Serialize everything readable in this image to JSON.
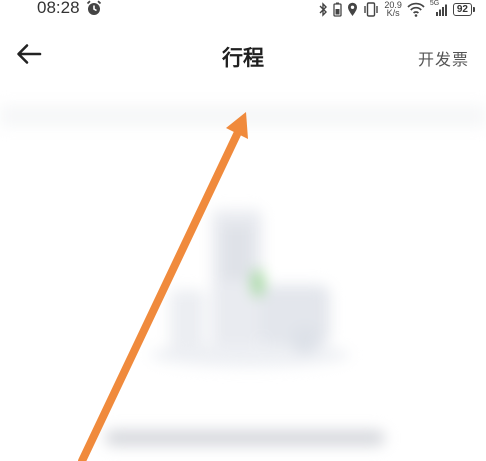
{
  "status_bar": {
    "time": "08:28",
    "net_speed_value": "20.9",
    "net_speed_unit": "K/s",
    "signal_label": "5G",
    "battery": "92",
    "icons": [
      "alarm-icon",
      "bluetooth-icon",
      "battery-saver-icon",
      "location-icon",
      "vibrate-icon",
      "wifi-icon",
      "signal-icon"
    ]
  },
  "header": {
    "back_icon": "arrow-left-icon",
    "title": "行程",
    "invoice_label": "开发票"
  },
  "annotation": {
    "arrow_color": "#f08a3c"
  }
}
